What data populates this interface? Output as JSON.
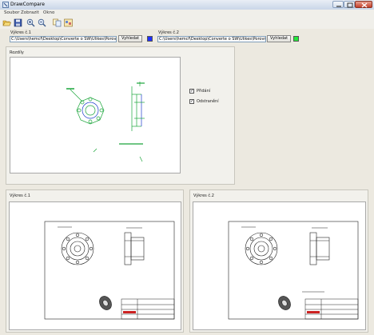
{
  "window": {
    "title": "DrawCompare"
  },
  "menu": [
    "Soubor",
    "Zobrazit",
    "Okno"
  ],
  "toolbar": [
    "open-icon",
    "save-icon",
    "zoom-in-icon",
    "zoom-out-icon",
    "compare-icon",
    "settings-icon"
  ],
  "file1": {
    "label": "Výkres č.1",
    "path": "C:\\Users\\hemcf\\Desktop\\Converte o SW\\Ulikes\\Porovnání",
    "button": "Vyhledat",
    "color": "#1f2fff"
  },
  "file2": {
    "label": "Výkres č.2",
    "path": "C:\\Users\\hemcf\\Desktop\\Converte o SW\\Ulikes\\Porovnání",
    "button": "Vyhledat",
    "color": "#24e83a"
  },
  "diff_panel": {
    "title": "Rozdíly",
    "options": [
      {
        "label": "Přidání",
        "checked": true
      },
      {
        "label": "Odstranění",
        "checked": true
      }
    ]
  },
  "panel1": {
    "title": "Výkres č.1"
  },
  "panel2": {
    "title": "Výkres č.2"
  }
}
